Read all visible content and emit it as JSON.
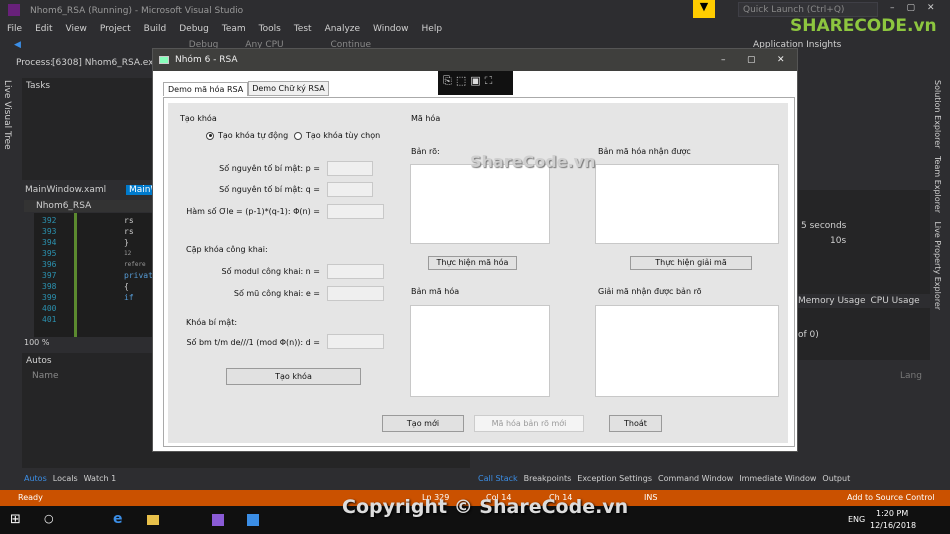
{
  "vs": {
    "title": "Nhom6_RSA (Running) - Microsoft Visual Studio",
    "menu": [
      "File",
      "Edit",
      "View",
      "Project",
      "Build",
      "Debug",
      "Team",
      "Tools",
      "Test",
      "Analyze",
      "Window",
      "Help"
    ],
    "quick_launch_placeholder": "Quick Launch (Ctrl+Q)",
    "config": "Debug",
    "platform": "Any CPU",
    "continue": "Continue",
    "app_insights": "Application Insights",
    "process_label": "Process:",
    "process_value": "[6308] Nhom6_RSA.exe",
    "live_visual_tree": "Live Visual Tree",
    "tasks": "Tasks",
    "editor_tabs": [
      "MainWindow.xaml",
      "MainW"
    ],
    "editor_scope": "Nhom6_RSA",
    "line_numbers": [
      "392",
      "393",
      "394",
      "395",
      "396",
      "397",
      "398",
      "399",
      "400",
      "401"
    ],
    "code_lines": [
      "",
      "rs",
      "rs",
      "",
      "}",
      "",
      "12 refere",
      "privat",
      "{",
      "if"
    ],
    "zoom": "100 %",
    "autos": "Autos",
    "autos_col": "Name",
    "bottom_left_tabs": [
      "Autos",
      "Locals",
      "Watch 1"
    ],
    "bottom_right_tabs": [
      "Call Stack",
      "Breakpoints",
      "Exception Settings",
      "Command Window",
      "Immediate Window",
      "Output"
    ],
    "diag_seconds": "5 seconds",
    "diag_tick": "10s",
    "diag_tabs": [
      "Memory Usage",
      "CPU Usage"
    ],
    "diag_count": "of 0)",
    "lang_col": "Lang",
    "right_strip": [
      "Solution Explorer",
      "Team Explorer",
      "Live Property Explorer"
    ],
    "status": {
      "ready": "Ready",
      "ln": "Ln 329",
      "col": "Col 14",
      "ch": "Ch 14",
      "ins": "INS",
      "source_control": "Add to Source Control"
    },
    "taskbar": {
      "time": "1:20 PM",
      "date": "12/16/2018",
      "lang": "ENG"
    },
    "watermark": "Copyright © ShareCode.vn",
    "watermark2": "ShareCode.vn",
    "logo": "SHARECODE.vn"
  },
  "dialog": {
    "title": "Nhóm 6 - RSA",
    "tabs": [
      "Demo mã hóa RSA",
      "Demo Chữ ký RSA"
    ],
    "keygen": {
      "heading": "Tạo khóa",
      "radio_auto": "Tạo khóa tự động",
      "radio_custom": "Tạo khóa tùy chọn",
      "p_label": "Số nguyên tố bí mật: p =",
      "q_label": "Số nguyên tố bí mật: q =",
      "phi_label": "Hàm số Ơle = (p-1)*(q-1): Φ(n) =",
      "public_heading": "Cặp khóa công khai:",
      "n_label": "Số modul công khai: n =",
      "e_label": "Số mũ công khai: e =",
      "private_heading": "Khóa bí mật:",
      "d_label": "Số bm t/m de///1 (mod Φ(n)): d =",
      "button": "Tạo khóa"
    },
    "encrypt": {
      "heading": "Mã hóa",
      "plain_label": "Bản rõ:",
      "received_label": "Bản mã hóa nhận được",
      "encrypt_button": "Thực hiện mã hóa",
      "decrypt_button": "Thực hiện giải mã",
      "cipher_label": "Bản mã hóa",
      "decrypted_label": "Giải mã nhận được bản rõ"
    },
    "footer": {
      "new": "Tạo mới",
      "encrypt_new": "Mã hóa bản rõ mới",
      "exit": "Thoát"
    }
  },
  "colors": {
    "vs_bg": "#2d2d30",
    "status": "#ca5100",
    "accent": "#007acc"
  }
}
